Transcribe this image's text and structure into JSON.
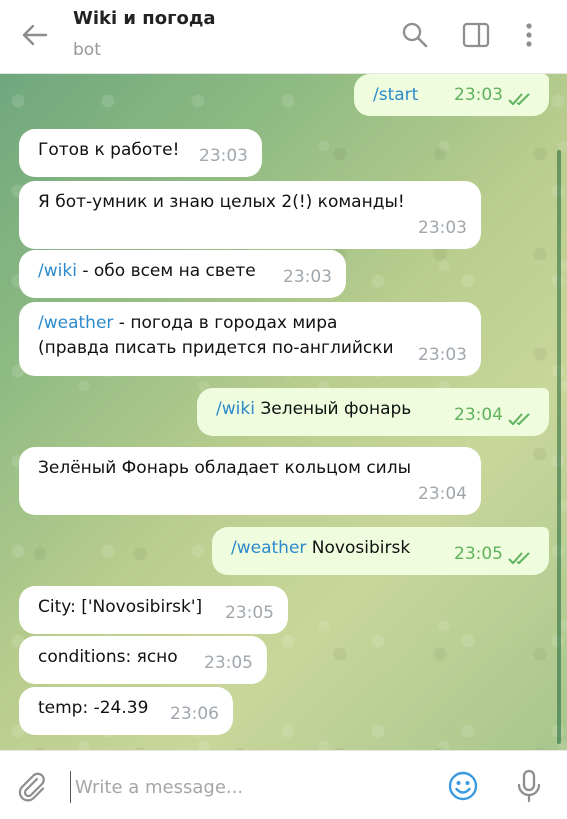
{
  "header": {
    "title": "Wiki и погода",
    "subtitle": "bot"
  },
  "messages": [
    {
      "dir": "out",
      "parts": [
        {
          "text": "/start",
          "link": true
        }
      ],
      "time": "23:03"
    },
    {
      "dir": "in",
      "parts": [
        {
          "text": "Готов к работе!"
        }
      ],
      "time": "23:03"
    },
    {
      "dir": "in",
      "parts": [
        {
          "text": "Я бот-умник и знаю целых 2(!) команды!"
        }
      ],
      "time": "23:03"
    },
    {
      "dir": "in",
      "parts": [
        {
          "text": "/wiki",
          "link": true
        },
        {
          "text": " - обо всем на свете"
        }
      ],
      "time": "23:03"
    },
    {
      "dir": "in",
      "parts": [
        {
          "text": "/weather",
          "link": true
        },
        {
          "text": " - погода в городах мира (правда писать придется по-английски"
        }
      ],
      "time": "23:03"
    },
    {
      "dir": "out",
      "parts": [
        {
          "text": "/wiki",
          "link": true
        },
        {
          "text": " Зеленый фонарь"
        }
      ],
      "time": "23:04"
    },
    {
      "dir": "in",
      "parts": [
        {
          "text": "Зелёный Фонарь обладает кольцом силы"
        }
      ],
      "time": "23:04"
    },
    {
      "dir": "out",
      "parts": [
        {
          "text": "/weather",
          "link": true
        },
        {
          "text": " Novosibirsk"
        }
      ],
      "time": "23:05"
    },
    {
      "dir": "in",
      "parts": [
        {
          "text": "City: ['Novosibirsk']"
        }
      ],
      "time": "23:05"
    },
    {
      "dir": "in",
      "parts": [
        {
          "text": "conditions: ясно"
        }
      ],
      "time": "23:05"
    },
    {
      "dir": "in",
      "parts": [
        {
          "text": "temp: -24.39"
        }
      ],
      "time": "23:06"
    }
  ],
  "input": {
    "placeholder": "Write a message..."
  },
  "icons": {
    "back": "arrow-left-icon",
    "search": "search-icon",
    "panel": "side-panel-icon",
    "more": "more-vertical-icon",
    "attach": "paperclip-icon",
    "emoji": "emoji-icon",
    "mic": "microphone-icon",
    "read": "double-check-icon"
  },
  "colors": {
    "link": "#2c8acb",
    "outgoing_bg": "#effdde",
    "outgoing_time": "#5fb35e",
    "incoming_time": "#a0a7ad",
    "accent": "#3a9be0"
  }
}
